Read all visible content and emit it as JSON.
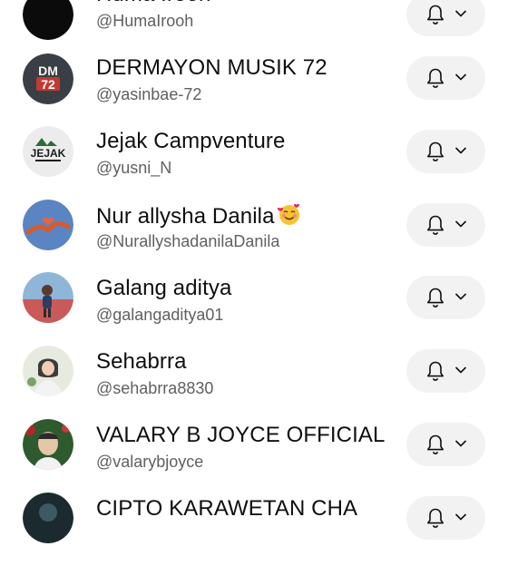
{
  "subscriptions": [
    {
      "name": "Huma Irooh",
      "handle": "@HumaIrooh",
      "avatar_icon": "dark-profile-avatar"
    },
    {
      "name": "DERMAYON MUSIK 72",
      "handle": "@yasinbae-72",
      "avatar_icon": "dm72-logo-avatar",
      "avatar_text_top": "DM",
      "avatar_text_bottom": "72"
    },
    {
      "name": "Jejak Campventure",
      "handle": "@yusni_N",
      "avatar_icon": "jejak-campventure-logo-avatar",
      "avatar_text": "JEJAK"
    },
    {
      "name": "Nur allysha  Danila",
      "handle": "@NurallyshadanilaDanila",
      "avatar_icon": "hands-heart-photo-avatar",
      "name_emoji": "🥰"
    },
    {
      "name": "Galang aditya",
      "handle": "@galangaditya01",
      "avatar_icon": "child-photo-avatar"
    },
    {
      "name": "Sehabrra",
      "handle": "@sehabrra8830",
      "avatar_icon": "woman-hijab-photo-avatar"
    },
    {
      "name": "VALARY B JOYCE OFFICIAL",
      "handle": "@valarybjoyce",
      "avatar_icon": "man-portrait-photo-avatar"
    },
    {
      "name": "CIPTO KARAWETAN CHA",
      "handle": "",
      "avatar_icon": "dark-photo-avatar"
    }
  ],
  "notification_button": {
    "icon": "bell-icon",
    "dropdown_icon": "chevron-down-icon"
  },
  "colors": {
    "text": "#0f0f0f",
    "secondary_text": "#606060",
    "pill_bg": "#f2f2f2",
    "background": "#ffffff"
  }
}
